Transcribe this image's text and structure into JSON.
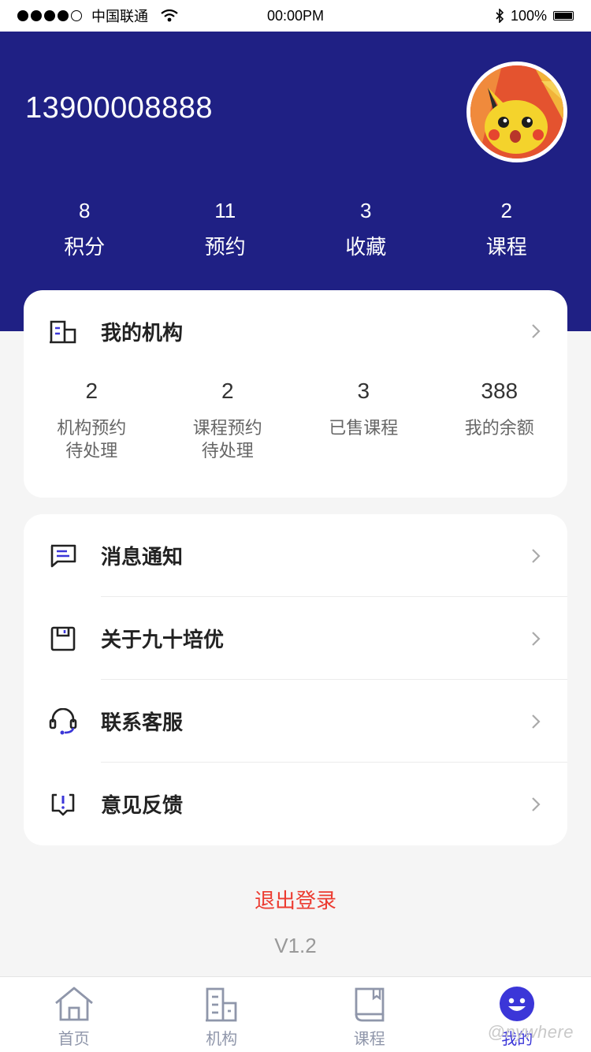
{
  "status_bar": {
    "carrier": "中国联通",
    "time": "00:00PM",
    "battery": "100%"
  },
  "profile": {
    "phone": "13900008888",
    "avatar_alt": "pikachu-avatar"
  },
  "stats": [
    {
      "value": "8",
      "label": "积分"
    },
    {
      "value": "11",
      "label": "预约"
    },
    {
      "value": "3",
      "label": "收藏"
    },
    {
      "value": "2",
      "label": "课程"
    }
  ],
  "org_card": {
    "title": "我的机构",
    "items": [
      {
        "value": "2",
        "label_line1": "机构预约",
        "label_line2": "待处理"
      },
      {
        "value": "2",
        "label_line1": "课程预约",
        "label_line2": "待处理"
      },
      {
        "value": "3",
        "label_line1": "已售课程",
        "label_line2": ""
      },
      {
        "value": "388",
        "label_line1": "我的余额",
        "label_line2": ""
      }
    ]
  },
  "menu": [
    {
      "label": "消息通知",
      "icon": "message-icon"
    },
    {
      "label": "关于九十培优",
      "icon": "about-icon"
    },
    {
      "label": "联系客服",
      "icon": "headset-icon"
    },
    {
      "label": "意见反馈",
      "icon": "feedback-icon"
    }
  ],
  "logout_label": "退出登录",
  "version": "V1.2",
  "tabbar": {
    "tabs": [
      {
        "label": "首页",
        "icon": "home-icon"
      },
      {
        "label": "机构",
        "icon": "building-icon"
      },
      {
        "label": "课程",
        "icon": "book-icon"
      },
      {
        "label": "我的",
        "icon": "user-icon"
      }
    ],
    "active_index": 3
  },
  "colors": {
    "header_bg": "#1f2084",
    "accent": "#3b36d8",
    "logout": "#ec3b30"
  }
}
